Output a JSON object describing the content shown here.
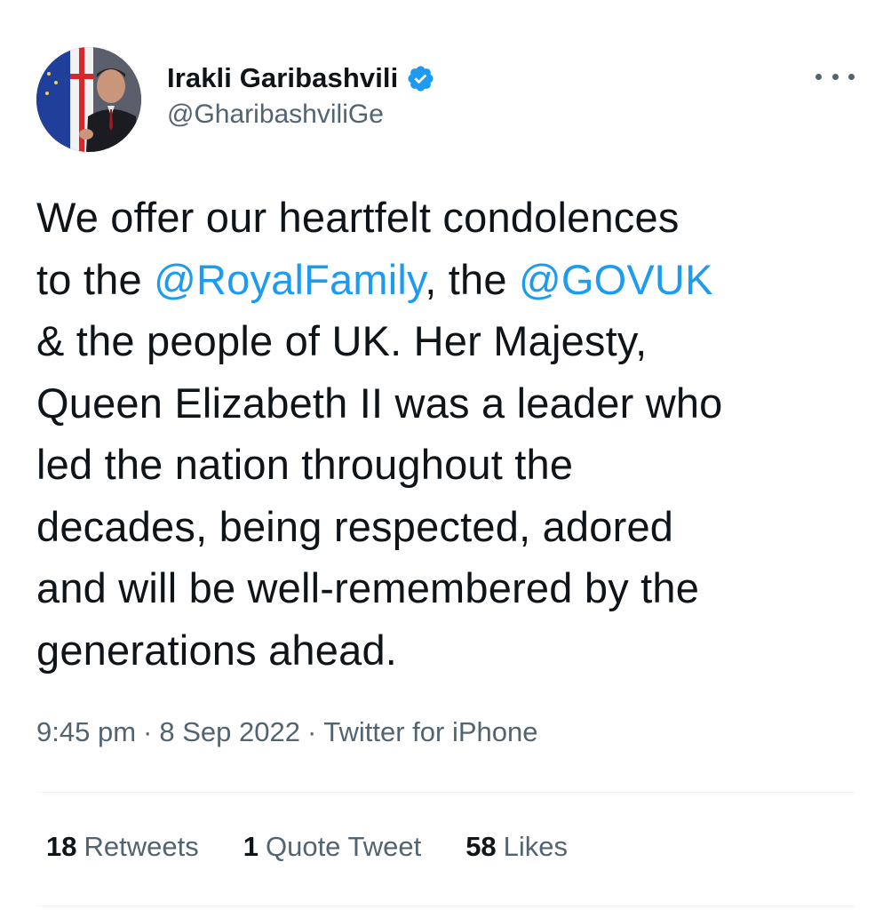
{
  "author": {
    "display_name": "Irakli Garibashvili",
    "handle": "@GharibashviliGe",
    "verified": true,
    "avatar_icon": "avatar-photo"
  },
  "tweet": {
    "lines": [
      [
        {
          "text": "We offer our heartfelt condolences",
          "type": "text"
        }
      ],
      [
        {
          "text": "to the ",
          "type": "text"
        },
        {
          "text": "@RoyalFamily",
          "type": "mention"
        },
        {
          "text": ", the ",
          "type": "text"
        },
        {
          "text": "@GOVUK",
          "type": "mention"
        }
      ],
      [
        {
          "text": "& the people of UK. Her Majesty,",
          "type": "text"
        }
      ],
      [
        {
          "text": "Queen Elizabeth II was a leader who",
          "type": "text"
        }
      ],
      [
        {
          "text": "led the nation throughout the",
          "type": "text"
        }
      ],
      [
        {
          "text": "decades, being respected, adored",
          "type": "text"
        }
      ],
      [
        {
          "text": "and will be well-remembered by the",
          "type": "text"
        }
      ],
      [
        {
          "text": "generations ahead.",
          "type": "text"
        }
      ]
    ]
  },
  "meta": {
    "time": "9:45 pm",
    "separator": "·",
    "date": "8 Sep 2022",
    "source": "Twitter for iPhone"
  },
  "stats": {
    "retweets_count": "18",
    "retweets_label": "Retweets",
    "quotes_count": "1",
    "quotes_label": "Quote Tweet",
    "likes_count": "58",
    "likes_label": "Likes"
  },
  "colors": {
    "accent": "#1d9bf0",
    "text_primary": "#0f1419",
    "text_secondary": "#536471",
    "divider": "#eff3f4"
  },
  "icons": {
    "verified": "verified-badge-icon",
    "more": "more-horizontal-icon"
  }
}
